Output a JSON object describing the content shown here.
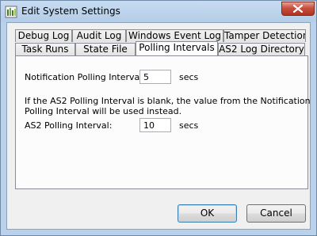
{
  "window": {
    "title": "Edit System Settings",
    "icon": "app-icon"
  },
  "tabs": {
    "row_back": [
      {
        "label": "Debug Log"
      },
      {
        "label": "Audit Log"
      },
      {
        "label": "Windows Event Log"
      },
      {
        "label": "Tamper Detection"
      }
    ],
    "row_front": [
      {
        "label": "Task Runs"
      },
      {
        "label": "State File"
      },
      {
        "label": "Polling Intervals"
      },
      {
        "label": "AS2 Log Directory"
      }
    ],
    "active": "Polling Intervals"
  },
  "polling": {
    "notification_label": "Notification Polling Interval:",
    "notification_value": "5",
    "notification_unit": "secs",
    "note_line1": "If the AS2 Polling Interval is blank, the value from the Notification",
    "note_line2": "Polling Interval will be used instead.",
    "as2_label": "AS2 Polling Interval:",
    "as2_value": "10",
    "as2_unit": "secs"
  },
  "buttons": {
    "ok": "OK",
    "cancel": "Cancel"
  },
  "colors": {
    "frame": "#b9d1ea",
    "close_button": "#c7503e",
    "dialog_background": "#f0f0f0",
    "tab_panel": "#fcfcfc"
  }
}
